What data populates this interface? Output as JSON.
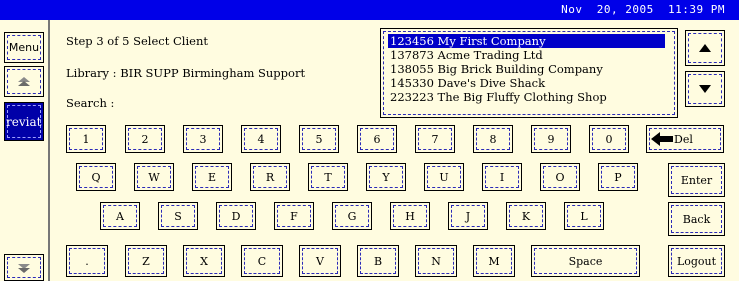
{
  "datetime": "Nov  20, 2005  11:39 PM",
  "colors": {
    "topbar": "#0000E8",
    "background": "#FFFCE0",
    "selection": "#0000C8"
  },
  "sidebar": {
    "menu_label": "Menu",
    "selected_label": "reviat",
    "up_icon": "double-up-arrow-icon",
    "down_icon": "double-down-arrow-icon"
  },
  "step": {
    "text": "Step 3 of 5  Select Client"
  },
  "library": {
    "text": "Library : BIR SUPP Birmingham Support"
  },
  "search": {
    "label": "Search :",
    "value": ""
  },
  "client_list": [
    {
      "text": "123456 My First Company",
      "selected": true
    },
    {
      "text": "137873 Acme Trading Ltd",
      "selected": false
    },
    {
      "text": "138055 Big Brick Building Company",
      "selected": false
    },
    {
      "text": "145330 Dave's Dive Shack",
      "selected": false
    },
    {
      "text": "223223 The Big Fluffy Clothing Shop",
      "selected": false
    }
  ],
  "scroll": {
    "up_icon": "triangle-up-icon",
    "down_icon": "triangle-down-icon"
  },
  "keyboard": {
    "row1": [
      "1",
      "2",
      "3",
      "4",
      "5",
      "6",
      "7",
      "8",
      "9",
      "0"
    ],
    "row2": [
      "Q",
      "W",
      "E",
      "R",
      "T",
      "Y",
      "U",
      "I",
      "O",
      "P"
    ],
    "row3": [
      "A",
      "S",
      "D",
      "F",
      "G",
      "H",
      "J",
      "K",
      "L"
    ],
    "row4": [
      ".",
      "Z",
      "X",
      "C",
      "V",
      "B",
      "N",
      "M"
    ],
    "del_label": "Del",
    "space_label": "Space"
  },
  "actions": {
    "enter_label": "Enter",
    "back_label": "Back",
    "logout_label": "Logout"
  }
}
